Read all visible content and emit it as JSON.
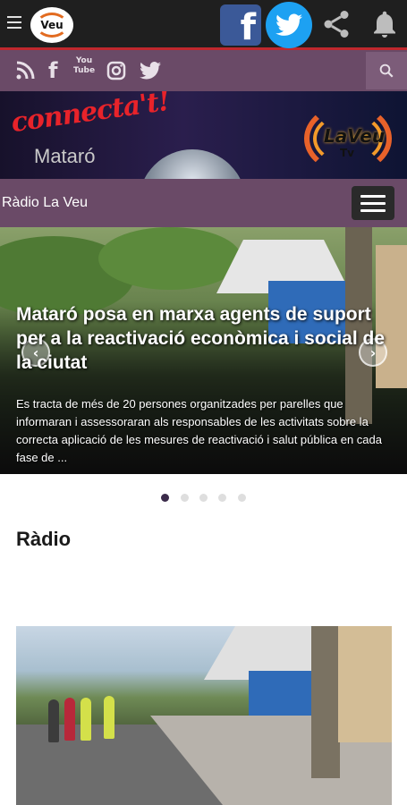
{
  "header": {
    "logo_text": "Veu",
    "icons": [
      "menu-icon",
      "facebook-icon",
      "twitter-icon",
      "share-icon",
      "notification-bell-icon"
    ]
  },
  "social_bar": {
    "icons": [
      "rss-icon",
      "facebook-icon",
      "youtube-icon",
      "instagram-icon",
      "twitter-icon",
      "search-icon"
    ],
    "youtube_label": "You Tube"
  },
  "banner": {
    "headline": "connecta't!",
    "city": "Mataró",
    "brand": "LaVeu",
    "brand_sub": "Tv"
  },
  "section": {
    "title": "Ràdio La Veu"
  },
  "hero": {
    "title": "Mataró posa en marxa agents de suport per a la reactivació econòmica i social de la ciutat",
    "description": "Es tracta de més de 20 persones organitzades per parelles que informaran i assessoraran als responsables de les activitats sobre la correcta aplicació de les mesures de reactivació i salut pública en cada fase de ...",
    "slides_total": 5,
    "active_slide": 1
  },
  "radio": {
    "title": "Ràdio"
  },
  "colors": {
    "topbar": "#1f1f1f",
    "accent_red": "#c0282d",
    "purple_bar": "#6a4a67",
    "active_dot": "#3b2b4a"
  }
}
